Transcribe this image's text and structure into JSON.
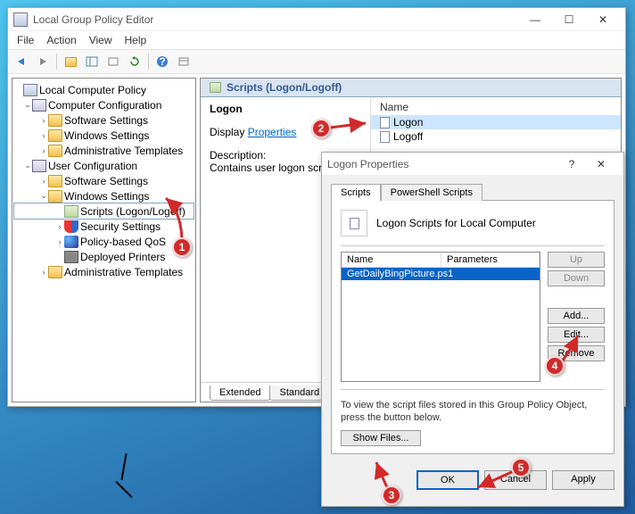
{
  "window": {
    "title": "Local Group Policy Editor"
  },
  "menu": {
    "file": "File",
    "action": "Action",
    "view": "View",
    "help": "Help"
  },
  "tree": {
    "root": "Local Computer Policy",
    "compconf": "Computer Configuration",
    "cc_soft": "Software Settings",
    "cc_win": "Windows Settings",
    "cc_admin": "Administrative Templates",
    "userconf": "User Configuration",
    "uc_soft": "Software Settings",
    "uc_win": "Windows Settings",
    "scripts": "Scripts (Logon/Logoff)",
    "security": "Security Settings",
    "qos": "Policy-based QoS",
    "printers": "Deployed Printers",
    "uc_admin": "Administrative Templates"
  },
  "detail": {
    "header": "Scripts (Logon/Logoff)",
    "logon": "Logon",
    "display": "Display",
    "properties_link": "Properties",
    "desc_label": "Description:",
    "desc_text": "Contains user logon scripts.",
    "col_name": "Name",
    "item_logon": "Logon",
    "item_logoff": "Logoff",
    "tab_extended": "Extended",
    "tab_standard": "Standard"
  },
  "dialog": {
    "title": "Logon Properties",
    "tab_scripts": "Scripts",
    "tab_ps": "PowerShell Scripts",
    "header": "Logon Scripts for Local Computer",
    "col_name": "Name",
    "col_params": "Parameters",
    "row_script": "GetDailyBingPicture.ps1",
    "btn_up": "Up",
    "btn_down": "Down",
    "btn_add": "Add...",
    "btn_edit": "Edit...",
    "btn_remove": "Remove",
    "foot_text": "To view the script files stored in this Group Policy Object, press the button below.",
    "btn_showfiles": "Show Files...",
    "btn_ok": "OK",
    "btn_cancel": "Cancel",
    "btn_apply": "Apply"
  },
  "markers": {
    "m1": "1",
    "m2": "2",
    "m3": "3",
    "m4": "4",
    "m5": "5"
  }
}
